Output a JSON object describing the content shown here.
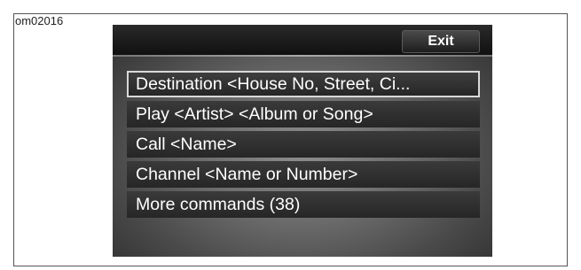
{
  "figure_id": "om02016",
  "screen": {
    "exit_label": "Exit",
    "menu_items": [
      {
        "label": "Destination <House No, Street, Ci...",
        "selected": true
      },
      {
        "label": "Play <Artist> <Album or Song>",
        "selected": false
      },
      {
        "label": "Call <Name>",
        "selected": false
      },
      {
        "label": "Channel <Name or Number>",
        "selected": false
      },
      {
        "label": "More commands (38)",
        "selected": false
      }
    ]
  }
}
